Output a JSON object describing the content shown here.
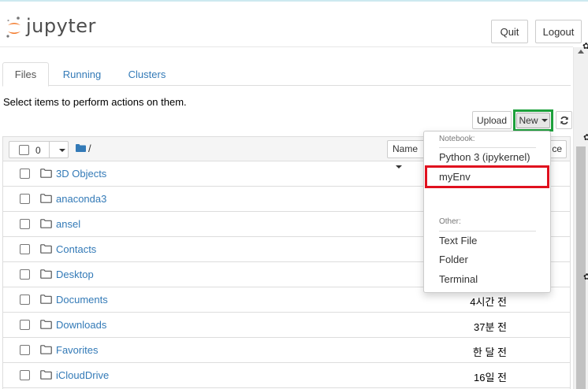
{
  "app": {
    "name": "jupyter"
  },
  "header": {
    "quit_label": "Quit",
    "logout_label": "Logout"
  },
  "tabs": [
    {
      "label": "Files",
      "active": true
    },
    {
      "label": "Running",
      "active": false
    },
    {
      "label": "Clusters",
      "active": false
    }
  ],
  "info_text": "Select items to perform actions on them.",
  "toolbar": {
    "upload_label": "Upload",
    "new_label": "New",
    "refresh_icon": "refresh-icon"
  },
  "list_header": {
    "selected_count": "0",
    "breadcrumb": "/",
    "sort_label": "Name",
    "sort_partial": "ce"
  },
  "files": [
    {
      "name": "3D Objects",
      "modified": ""
    },
    {
      "name": "anaconda3",
      "modified": ""
    },
    {
      "name": "ansel",
      "modified": ""
    },
    {
      "name": "Contacts",
      "modified": ""
    },
    {
      "name": "Desktop",
      "modified": ""
    },
    {
      "name": "Documents",
      "modified": "4시간 전"
    },
    {
      "name": "Downloads",
      "modified": "37분 전"
    },
    {
      "name": "Favorites",
      "modified": "한 달 전"
    },
    {
      "name": "iCloudDrive",
      "modified": "16일 전"
    }
  ],
  "new_menu": {
    "notebook_header": "Notebook:",
    "kernels": [
      "Python 3 (ipykernel)",
      "myEnv"
    ],
    "other_header": "Other:",
    "other_items": [
      "Text File",
      "Folder",
      "Terminal"
    ]
  },
  "colors": {
    "link": "#337ab7",
    "new_highlight": "#1ea03c",
    "myenv_highlight": "#e0101e",
    "logo_orange": "#f37726"
  }
}
